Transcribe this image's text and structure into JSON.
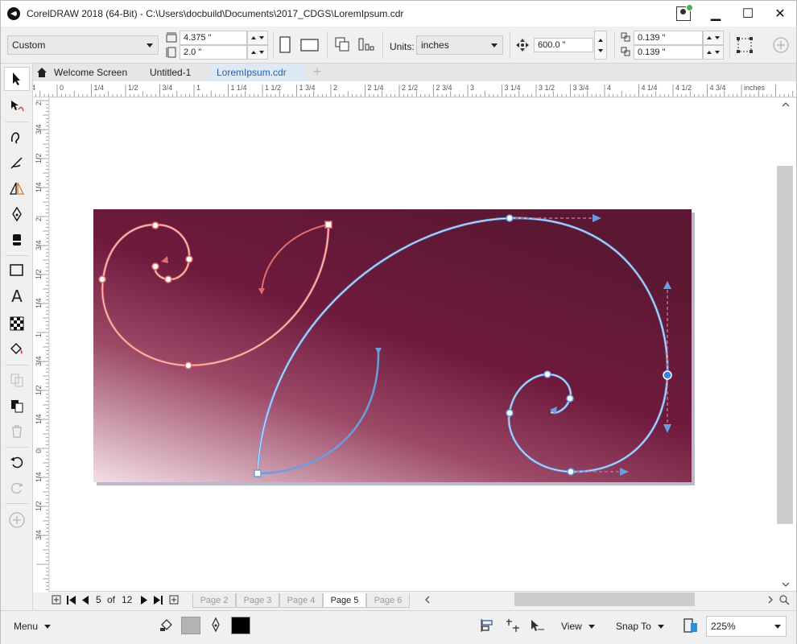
{
  "window": {
    "title": "CorelDRAW 2018 (64-Bit) - C:\\Users\\docbuild\\Documents\\2017_CDGS\\LoremIpsum.cdr",
    "controls": {
      "minimize": "▁",
      "maximize": "☐",
      "close": "✕"
    }
  },
  "propbar": {
    "page_preset": "Custom",
    "width_value": "4.375 \"",
    "height_value": "2.0 \"",
    "units_label": "Units:",
    "units_value": "inches",
    "nudge_value": "600.0 \"",
    "dup_x_value": "0.139 \"",
    "dup_y_value": "0.139 \""
  },
  "tabs": {
    "welcome": "Welcome Screen",
    "untitled": "Untitled-1",
    "active": "LoremIpsum.cdr"
  },
  "ruler": {
    "h_ticks": [
      {
        "t": "1/4"
      },
      {
        "t": "0"
      },
      {
        "t": "1/4"
      },
      {
        "t": "1/2"
      },
      {
        "t": "3/4"
      },
      {
        "t": "1"
      },
      {
        "t": "1 1/4"
      },
      {
        "t": "1 1/2"
      },
      {
        "t": "1 3/4"
      },
      {
        "t": "2"
      },
      {
        "t": "2 1/4"
      },
      {
        "t": "2 1/2"
      },
      {
        "t": "2 3/4"
      },
      {
        "t": "3"
      },
      {
        "t": "3 1/4"
      },
      {
        "t": "3 1/2"
      },
      {
        "t": "3 3/4"
      },
      {
        "t": "4"
      },
      {
        "t": "4 1/4"
      },
      {
        "t": "4 1/2"
      },
      {
        "t": "4 3/4"
      },
      {
        "t": "inches"
      }
    ],
    "v_ticks": [
      {
        "t": "2"
      },
      {
        "t": "3/4"
      },
      {
        "t": "1/2"
      },
      {
        "t": "1/4"
      },
      {
        "t": "2"
      },
      {
        "t": "3/4"
      },
      {
        "t": "1/2"
      },
      {
        "t": "1/4"
      },
      {
        "t": "1"
      },
      {
        "t": "3/4"
      },
      {
        "t": "1/2"
      },
      {
        "t": "1/4"
      },
      {
        "t": "0"
      },
      {
        "t": "1/4"
      },
      {
        "t": "1/2"
      },
      {
        "t": "3/4"
      }
    ]
  },
  "pagenav": {
    "current": "5",
    "of_label": "of",
    "total": "12",
    "tabs": [
      "Page 2",
      "Page 3",
      "Page 4",
      "Page 5",
      "Page 6"
    ],
    "active_tab": "Page 5"
  },
  "status": {
    "menu": "Menu",
    "view": "View",
    "snap": "Snap To",
    "zoom": "225%",
    "fill_color": "#b3b3b3",
    "outline_color": "#000000"
  },
  "colors": {
    "accent": "#2b5fa5",
    "page_bg_dark": "#6a1a3a",
    "spiral_red": "#e05a5a",
    "spiral_blue": "#5b8fd6"
  }
}
